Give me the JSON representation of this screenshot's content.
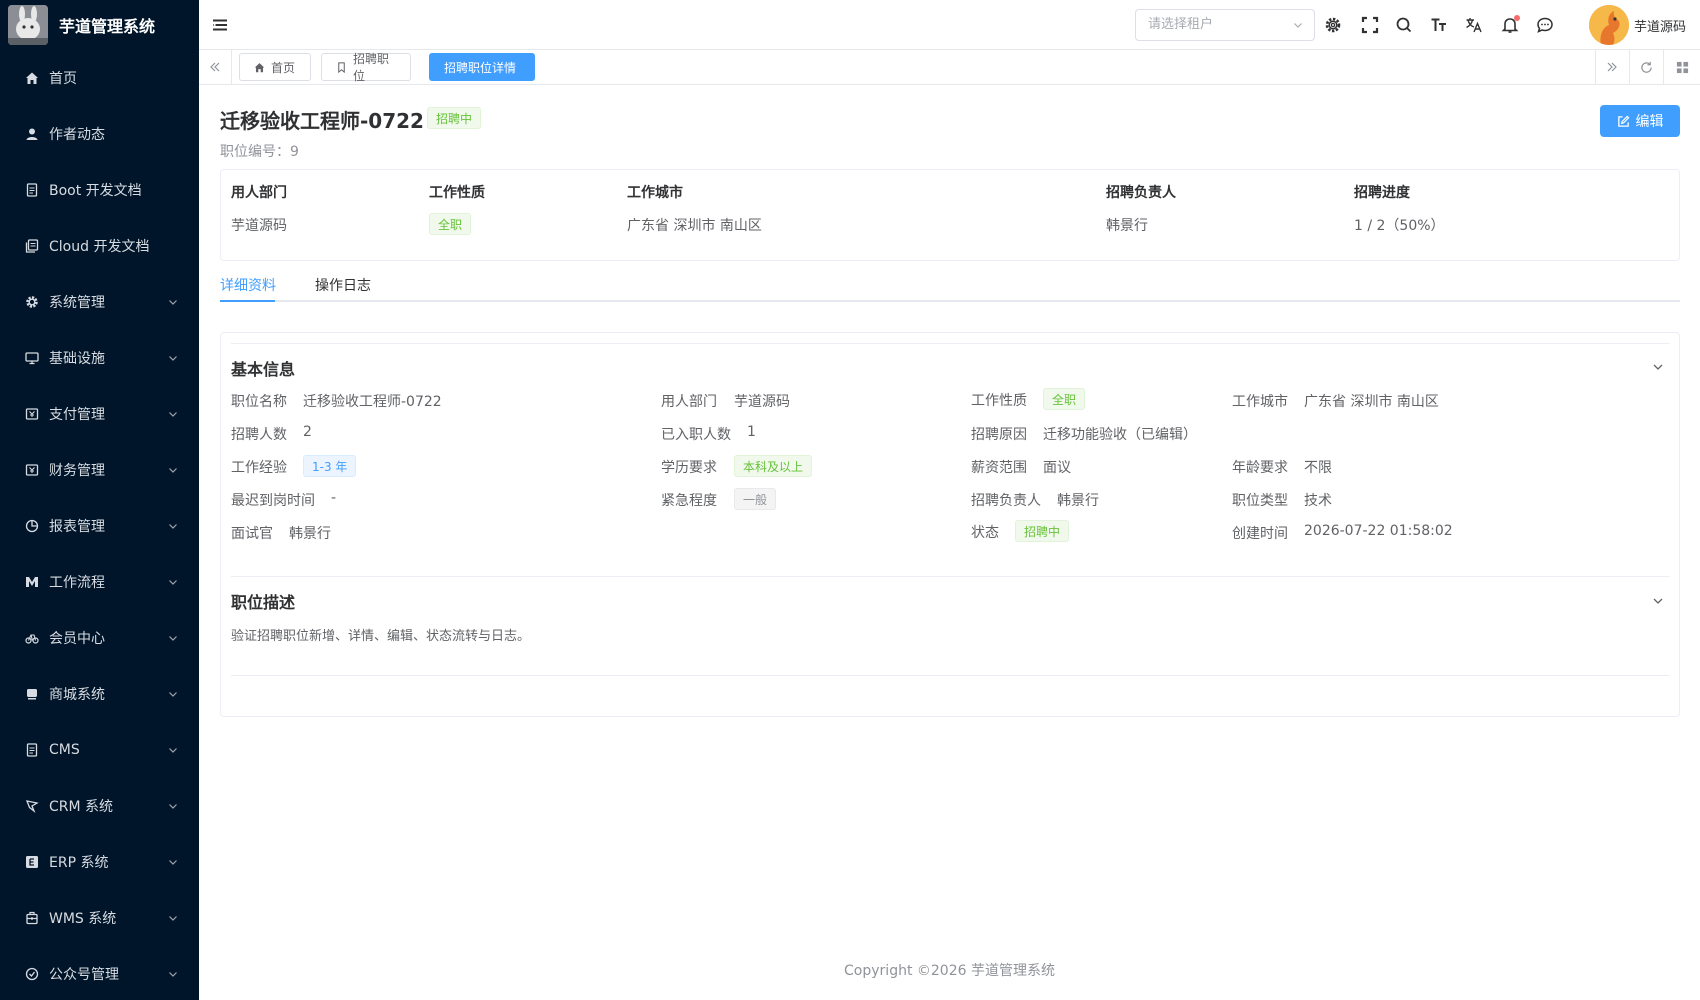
{
  "app": {
    "title": "芋道管理系统"
  },
  "sidebar": {
    "items": [
      {
        "label": "首页",
        "icon": "home-icon",
        "expandable": false
      },
      {
        "label": "作者动态",
        "icon": "user-icon",
        "expandable": false
      },
      {
        "label": "Boot 开发文档",
        "icon": "document-icon",
        "expandable": false
      },
      {
        "label": "Cloud 开发文档",
        "icon": "documents-icon",
        "expandable": false
      },
      {
        "label": "系统管理",
        "icon": "gear-icon",
        "expandable": true
      },
      {
        "label": "基础设施",
        "icon": "monitor-icon",
        "expandable": true
      },
      {
        "label": "支付管理",
        "icon": "payment-icon",
        "expandable": true
      },
      {
        "label": "财务管理",
        "icon": "finance-icon",
        "expandable": true
      },
      {
        "label": "报表管理",
        "icon": "pie-chart-icon",
        "expandable": true
      },
      {
        "label": "工作流程",
        "icon": "workflow-icon",
        "expandable": true
      },
      {
        "label": "会员中心",
        "icon": "bicycle-icon",
        "expandable": true
      },
      {
        "label": "商城系统",
        "icon": "shop-icon",
        "expandable": true
      },
      {
        "label": "CMS",
        "icon": "cms-icon",
        "expandable": true
      },
      {
        "label": "CRM 系统",
        "icon": "crm-icon",
        "expandable": true
      },
      {
        "label": "ERP 系统",
        "icon": "erp-icon",
        "expandable": true
      },
      {
        "label": "WMS 系统",
        "icon": "warehouse-icon",
        "expandable": true
      },
      {
        "label": "公众号管理",
        "icon": "wechat-icon",
        "expandable": true
      }
    ]
  },
  "header": {
    "tenant_placeholder": "请选择租户",
    "user_name": "芋道源码"
  },
  "tags": {
    "items": [
      {
        "label": "首页",
        "icon": "home-icon",
        "active": false
      },
      {
        "label": "招聘职位",
        "icon": "bookmark-icon",
        "active": false
      },
      {
        "label": "招聘职位详情",
        "icon": "",
        "active": true
      }
    ]
  },
  "job": {
    "title": "迁移验收工程师-0722",
    "status": "招聘中",
    "number_label": "职位编号：",
    "number": "9",
    "edit_label": "编辑"
  },
  "summary": {
    "columns": [
      {
        "header": "用人部门",
        "value": "芋道源码",
        "badge": false
      },
      {
        "header": "工作性质",
        "value": "全职",
        "badge": true
      },
      {
        "header": "工作城市",
        "value": "广东省 深圳市 南山区",
        "badge": false
      },
      {
        "header": "招聘负责人",
        "value": "韩景行",
        "badge": false
      },
      {
        "header": "招聘进度",
        "value": "1 / 2（50%）",
        "badge": false
      }
    ]
  },
  "tabs": [
    {
      "label": "详细资料",
      "active": true
    },
    {
      "label": "操作日志",
      "active": false
    }
  ],
  "basic_info": {
    "section_title": "基本信息",
    "fields": {
      "position_name": {
        "label": "职位名称",
        "value": "迁移验收工程师-0722"
      },
      "department": {
        "label": "用人部门",
        "value": "芋道源码"
      },
      "job_type": {
        "label": "工作性质",
        "value": "全职"
      },
      "city": {
        "label": "工作城市",
        "value": "广东省 深圳市 南山区"
      },
      "headcount": {
        "label": "招聘人数",
        "value": "2"
      },
      "hired": {
        "label": "已入职人数",
        "value": "1"
      },
      "reason": {
        "label": "招聘原因",
        "value": "迁移功能验收（已编辑）"
      },
      "experience": {
        "label": "工作经验",
        "value": "1-3 年"
      },
      "education": {
        "label": "学历要求",
        "value": "本科及以上"
      },
      "salary": {
        "label": "薪资范围",
        "value": "面议"
      },
      "age": {
        "label": "年龄要求",
        "value": "不限"
      },
      "latest_onboard": {
        "label": "最迟到岗时间",
        "value": "-"
      },
      "urgency": {
        "label": "紧急程度",
        "value": "一般"
      },
      "recruiter": {
        "label": "招聘负责人",
        "value": "韩景行"
      },
      "position_type": {
        "label": "职位类型",
        "value": "技术"
      },
      "interviewer": {
        "label": "面试官",
        "value": "韩景行"
      },
      "status": {
        "label": "状态",
        "value": "招聘中"
      },
      "created": {
        "label": "创建时间",
        "value": "2026-07-22 01:58:02"
      }
    }
  },
  "description": {
    "section_title": "职位描述",
    "text": "验证招聘职位新增、详情、编辑、状态流转与日志。"
  },
  "footer": {
    "copyright": "Copyright ©2026 芋道管理系统"
  },
  "colors": {
    "sidebar_bg": "#001529",
    "primary": "#409eff",
    "success": "#67c23a"
  }
}
